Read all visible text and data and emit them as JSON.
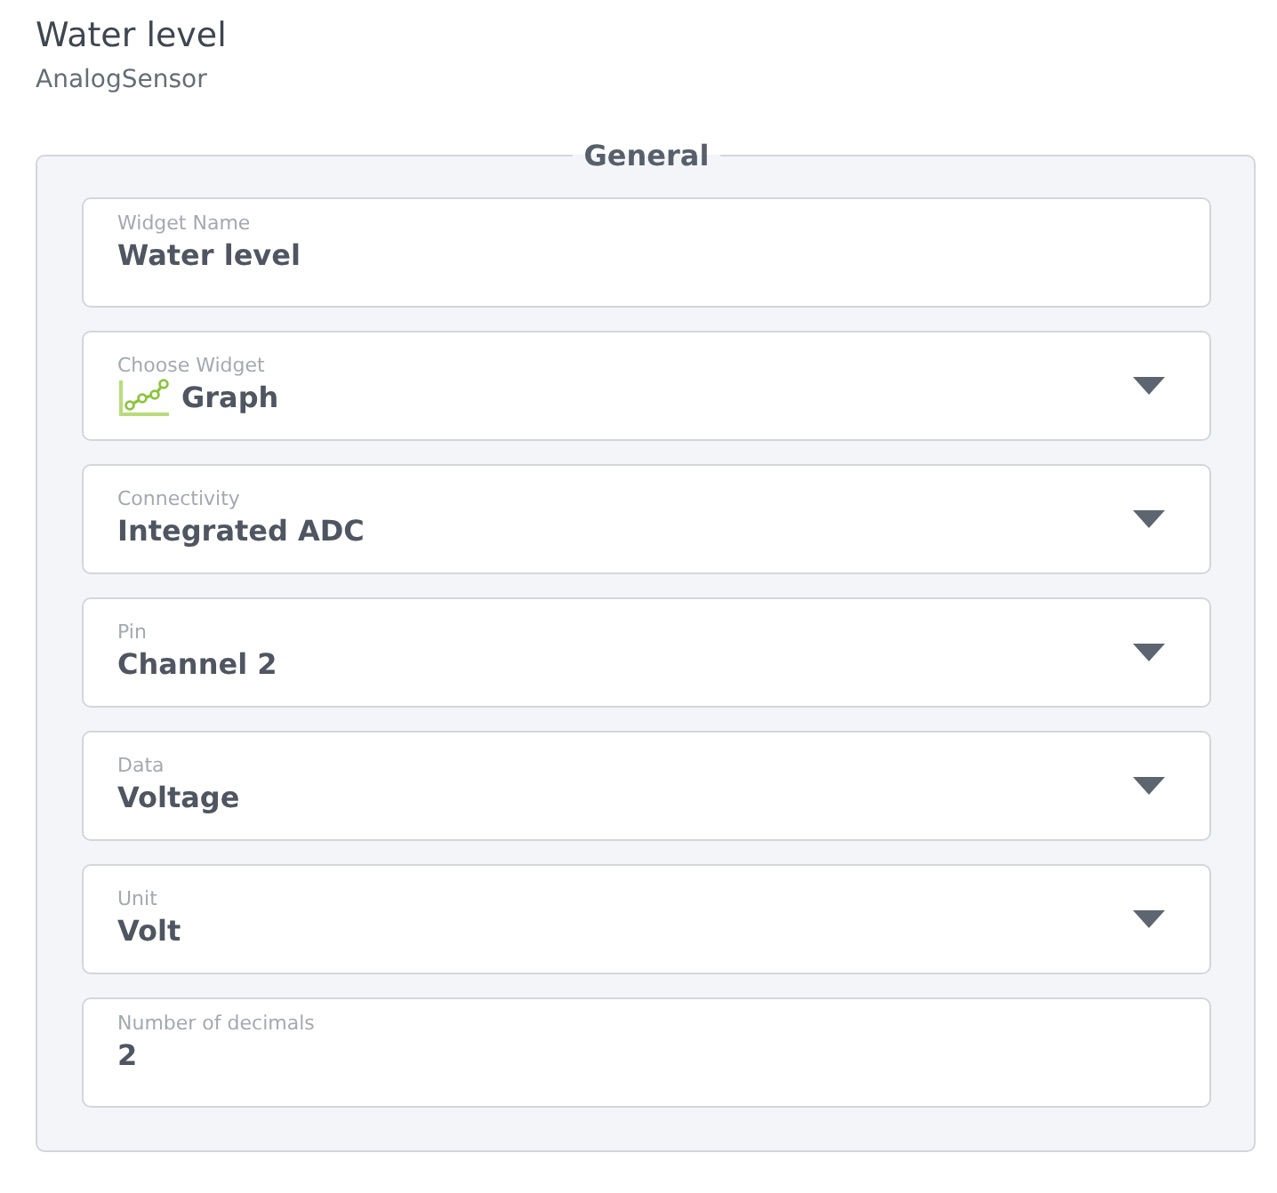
{
  "header": {
    "title": "Water level",
    "subtitle": "AnalogSensor"
  },
  "section": {
    "legend": "General",
    "fields": [
      {
        "kind": "text",
        "label": "Widget Name",
        "value": "Water level"
      },
      {
        "kind": "widget-select",
        "label": "Choose Widget",
        "value": "Graph"
      },
      {
        "kind": "select",
        "label": "Connectivity",
        "value": "Integrated ADC"
      },
      {
        "kind": "select",
        "label": "Pin",
        "value": "Channel 2"
      },
      {
        "kind": "select",
        "label": "Data",
        "value": "Voltage"
      },
      {
        "kind": "select",
        "label": "Unit",
        "value": "Volt"
      },
      {
        "kind": "text",
        "label": "Number of decimals",
        "value": "2"
      }
    ]
  }
}
